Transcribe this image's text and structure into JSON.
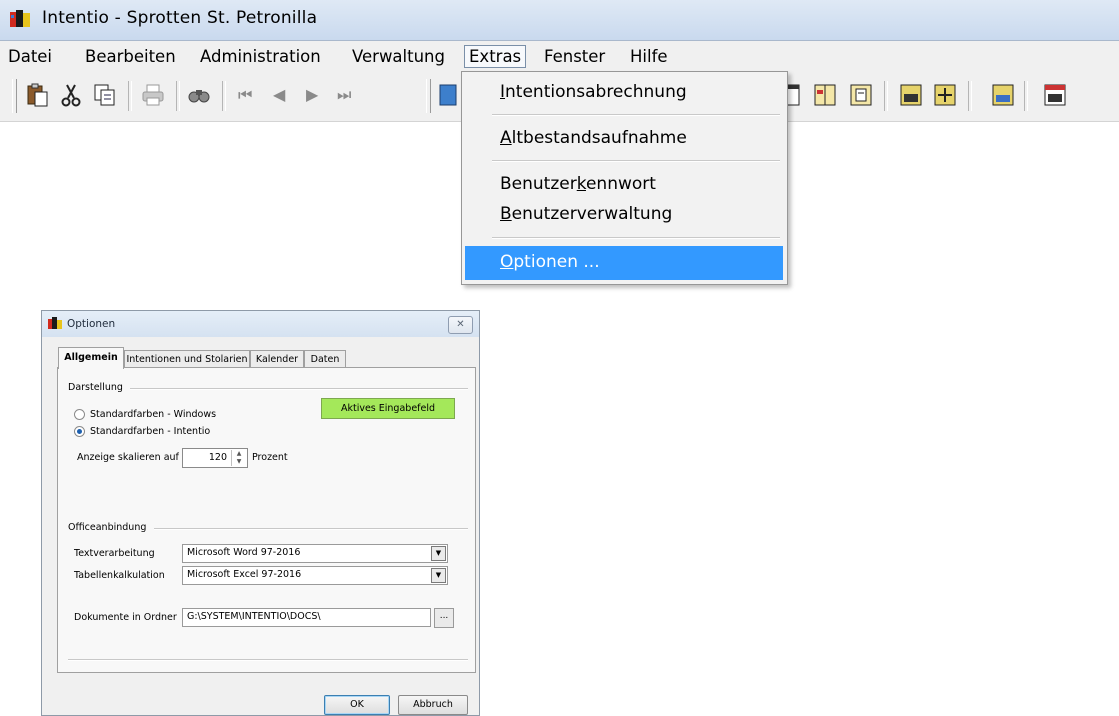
{
  "window": {
    "title": "Intentio - Sprotten St. Petronilla"
  },
  "menubar": {
    "items": [
      {
        "label": "Datei"
      },
      {
        "label": "Bearbeiten"
      },
      {
        "label": "Administration"
      },
      {
        "label": "Verwaltung"
      },
      {
        "label": "Extras"
      },
      {
        "label": "Fenster"
      },
      {
        "label": "Hilfe"
      }
    ],
    "open_item": "Extras"
  },
  "toolbar": {
    "icons": [
      "paste-icon",
      "cut-icon",
      "copy-icon",
      "print-icon",
      "find-icon",
      "first-record-icon",
      "previous-record-icon",
      "next-record-icon",
      "last-record-icon"
    ],
    "nav_glyphs": {
      "first": "⏮",
      "prev": "◀",
      "next": "▶",
      "last": "⏭"
    }
  },
  "extras_menu": {
    "items": [
      {
        "label_pre": "",
        "label_u": "I",
        "label_post": "ntentionsabrechnung"
      },
      {
        "label_pre": "",
        "label_u": "A",
        "label_post": "ltbestandsaufnahme"
      },
      {
        "label_pre": "Benutzer",
        "label_u": "k",
        "label_post": "ennwort"
      },
      {
        "label_pre": "",
        "label_u": "B",
        "label_post": "enutzerverwaltung"
      },
      {
        "label_pre": "",
        "label_u": "O",
        "label_post": "ptionen ..."
      }
    ],
    "highlighted": "Optionen ..."
  },
  "dialog": {
    "title": "Optionen",
    "close_glyph": "✕",
    "tabs": [
      {
        "label": "Allgemein",
        "active": true
      },
      {
        "label": "Intentionen und Stolarien",
        "active": false
      },
      {
        "label": "Kalender",
        "active": false
      },
      {
        "label": "Daten",
        "active": false
      }
    ],
    "darstellung": {
      "group_label": "Darstellung",
      "radio_windows": "Standardfarben - Windows",
      "radio_intentio": "Standardfarben - Intentio",
      "selected": "Standardfarben - Intentio",
      "active_field_button": "Aktives Eingabefeld",
      "active_field_color": "#a4e85a",
      "scale_label": "Anzeige skalieren auf",
      "scale_value": "120",
      "scale_unit": "Prozent"
    },
    "office": {
      "group_label": "Officeanbindung",
      "text_label": "Textverarbeitung",
      "text_value": "Microsoft Word 97-2016",
      "sheet_label": "Tabellenkalkulation",
      "sheet_value": "Microsoft Excel 97-2016",
      "docs_label": "Dokumente in Ordner",
      "docs_value": "G:\\SYSTEM\\INTENTIO\\DOCS\\",
      "browse_label": "..."
    },
    "buttons": {
      "ok": "OK",
      "cancel": "Abbruch"
    }
  },
  "colors": {
    "menu_highlight": "#3399ff",
    "titlebar": "#d5e2f1"
  }
}
